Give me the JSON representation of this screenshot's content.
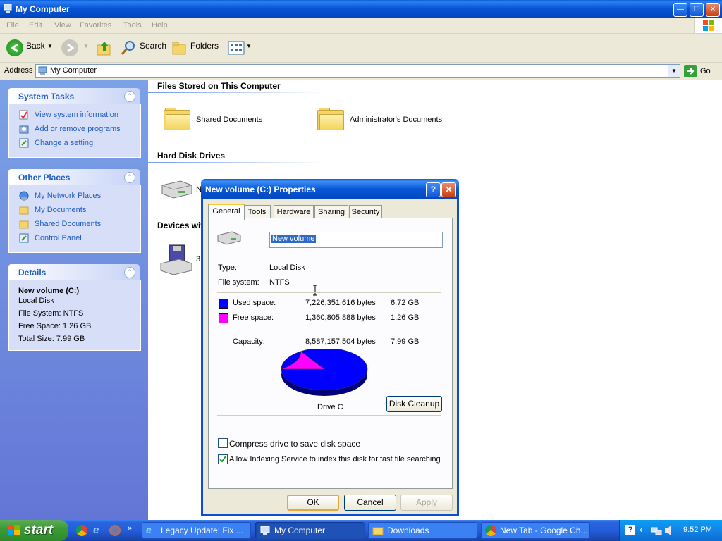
{
  "window": {
    "title": "My Computer"
  },
  "menu": [
    "File",
    "Edit",
    "View",
    "Favorites",
    "Tools",
    "Help"
  ],
  "toolbar": {
    "back": "Back",
    "search": "Search",
    "folders": "Folders"
  },
  "address": {
    "label": "Address",
    "value": "My Computer",
    "go": "Go"
  },
  "left": {
    "system_tasks": {
      "title": "System Tasks",
      "items": [
        "View system information",
        "Add or remove programs",
        "Change a setting"
      ]
    },
    "other_places": {
      "title": "Other Places",
      "items": [
        "My Network Places",
        "My Documents",
        "Shared Documents",
        "Control Panel"
      ]
    },
    "details": {
      "title": "Details",
      "name": "New volume (C:)",
      "type": "Local Disk",
      "fs": "File System: NTFS",
      "free": "Free Space: 1.26 GB",
      "total": "Total Size: 7.99 GB"
    }
  },
  "main": {
    "files_header": "Files Stored on This Computer",
    "folders": [
      "Shared Documents",
      "Administrator's Documents"
    ],
    "hdd_header": "Hard Disk Drives",
    "hdd_label_visible": "N",
    "devices_header_visible": "Devices wit",
    "devices_label_visible": "3"
  },
  "dialog": {
    "title": "New volume (C:) Properties",
    "help": "?",
    "tabs": [
      "General",
      "Tools",
      "Hardware",
      "Sharing",
      "Security"
    ],
    "volume_name": "New volume",
    "type_label": "Type:",
    "type_value": "Local Disk",
    "fs_label": "File system:",
    "fs_value": "NTFS",
    "used_label": "Used space:",
    "used_bytes": "7,226,351,616 bytes",
    "used_gb": "6.72 GB",
    "free_label": "Free space:",
    "free_bytes": "1,360,805,888 bytes",
    "free_gb": "1.26 GB",
    "cap_label": "Capacity:",
    "cap_bytes": "8,587,157,504 bytes",
    "cap_gb": "7.99 GB",
    "drive_label": "Drive C",
    "cleanup": "Disk Cleanup",
    "compress": "Compress drive to save disk space",
    "compress_checked": false,
    "indexing": "Allow Indexing Service to index this disk for fast file searching",
    "indexing_checked": true,
    "ok": "OK",
    "cancel": "Cancel",
    "apply": "Apply",
    "used_color": "#0000ff",
    "free_color": "#ff00ff",
    "used_fraction": 0.8415
  },
  "taskbar": {
    "start": "start",
    "tasks": [
      "Legacy Update: Fix ...",
      "My Computer",
      "Downloads",
      "New Tab - Google Ch..."
    ],
    "time": "9:52 PM"
  }
}
